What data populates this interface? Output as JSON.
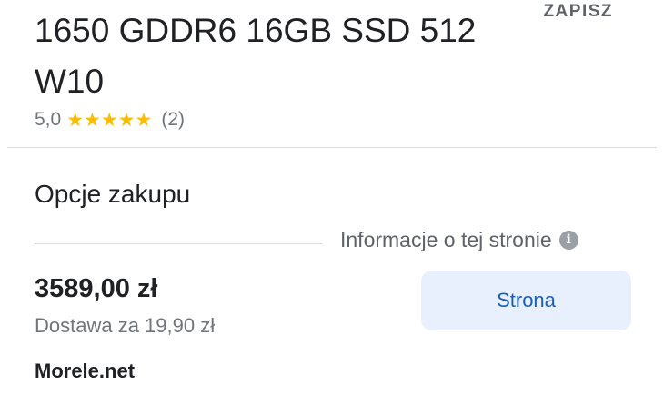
{
  "product": {
    "title": "1650 GDDR6 16GB SSD 512 W10",
    "save_label": "ZAPISZ",
    "rating_value": "5,0",
    "stars": "★★★★★",
    "review_count": "(2)"
  },
  "purchase": {
    "section_title": "Opcje zakupu",
    "page_info_label": "Informacje o tej stronie",
    "info_icon_glyph": "i",
    "offer": {
      "price": "3589,00 zł",
      "delivery": "Dostawa za 19,90 zł",
      "merchant": "Morele.net",
      "button_label": "Strona"
    }
  },
  "colors": {
    "star": "#fbbc04",
    "button_bg": "#e8f0fe",
    "button_text": "#1a5fb4",
    "divider": "#dadce0"
  },
  "icons": {
    "star": "star-icon",
    "info": "info-icon"
  }
}
